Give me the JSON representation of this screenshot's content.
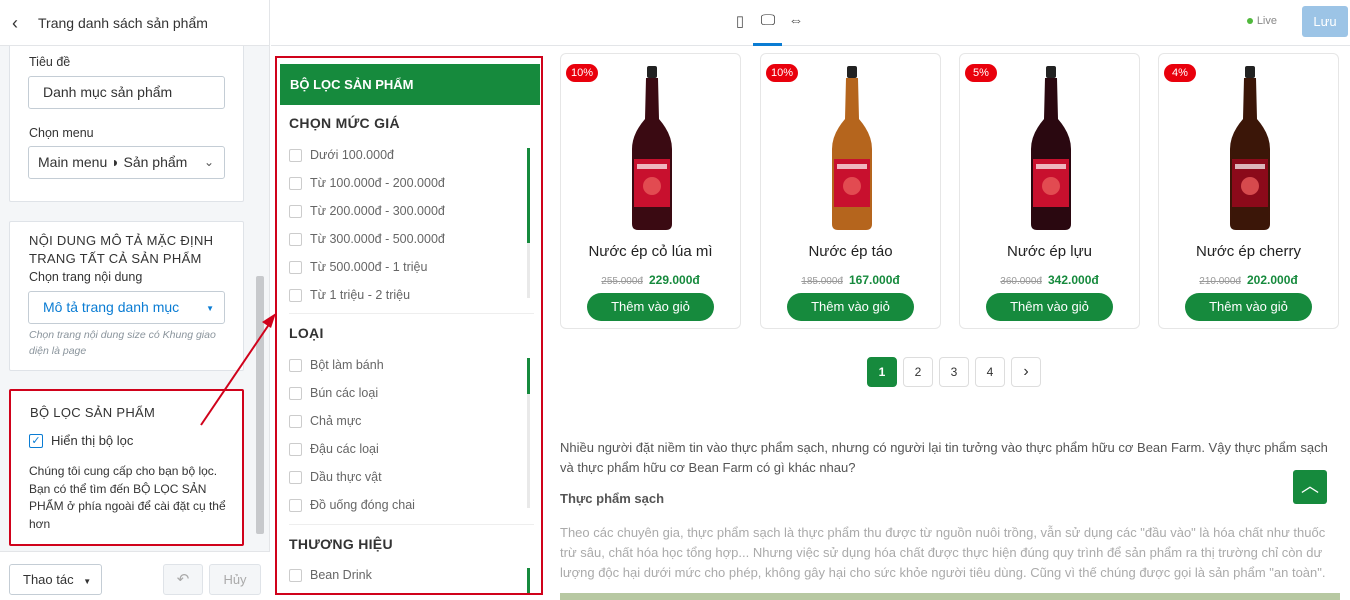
{
  "panel": {
    "title": "Trang danh sách sản phẩm",
    "back_icon": "chevron-left-icon",
    "field_title_label": "Tiêu đề",
    "field_title_value": "Danh mục sản phẩm",
    "field_menu_label": "Chọn menu",
    "field_menu_value": "Main menu ◗ Sản phẩm",
    "desc_section_heading": "NỘI DUNG MÔ TẢ MẶC ĐỊNH TRANG TẤT CẢ SẢN PHẨM",
    "desc_select_label": "Chọn trang nội dung",
    "desc_select_value": "Mô tả trang danh mục",
    "desc_hint": "Chọn trang nội dung size có Khung giao diện là page",
    "filter_heading": "BỘ LỌC SẢN PHẨM",
    "filter_checkbox_label": "Hiển thị bộ lọc",
    "filter_checked": true,
    "filter_desc": "Chúng tôi cung cấp cho bạn bộ lọc. Bạn có thể tìm đến BỘ LỌC SẢN PHẨM ở phía ngoài để cài đặt cụ thể hơn",
    "actions_label": "Thao tác",
    "undo_icon": "undo-icon",
    "cancel_label": "Hủy"
  },
  "topbar": {
    "devices": [
      "mobile-icon",
      "desktop-icon",
      "fullwidth-icon"
    ],
    "live_label": "Live",
    "save_label": "Lưu"
  },
  "filter": {
    "header": "BỘ LỌC SẢN PHẨM",
    "price_title": "CHỌN MỨC GIÁ",
    "price_options": [
      "Dưới 100.000đ",
      "Từ 100.000đ - 200.000đ",
      "Từ 200.000đ - 300.000đ",
      "Từ 300.000đ - 500.000đ",
      "Từ 500.000đ - 1 triệu",
      "Từ 1 triệu - 2 triệu"
    ],
    "type_title": "LOẠI",
    "type_options": [
      "Bột làm bánh",
      "Bún các loại",
      "Chả mực",
      "Đậu các loại",
      "Dầu thực vật",
      "Đồ uống đóng chai"
    ],
    "brand_title": "THƯƠNG HIỆU",
    "brand_options": [
      "Bean Drink"
    ]
  },
  "products": [
    {
      "name": "Nước ép cỏ lúa mì",
      "discount": "10%",
      "old_price": "255.000đ",
      "price": "229.000đ",
      "button": "Thêm vào giỏ",
      "label_color": "#c8102e",
      "bottle_color": "#3a0a12"
    },
    {
      "name": "Nước ép táo",
      "discount": "10%",
      "old_price": "185.000đ",
      "price": "167.000đ",
      "button": "Thêm vào giỏ",
      "label_color": "#c8102e",
      "bottle_color": "#b5651d"
    },
    {
      "name": "Nước ép lựu",
      "discount": "5%",
      "old_price": "360.000đ",
      "price": "342.000đ",
      "button": "Thêm vào giỏ",
      "label_color": "#c8102e",
      "bottle_color": "#2a0810"
    },
    {
      "name": "Nước ép cherry",
      "discount": "4%",
      "old_price": "210.000đ",
      "price": "202.000đ",
      "button": "Thêm vào giỏ",
      "label_color": "#8b0a1a",
      "bottle_color": "#3b1608"
    }
  ],
  "pagination": {
    "pages": [
      "1",
      "2",
      "3",
      "4"
    ],
    "current": "1",
    "next_icon": "chevron-right-icon"
  },
  "article": {
    "intro": "Nhiều người đặt niềm tin vào thực phẩm sạch, nhưng có người lại tin tưởng vào thực phẩm hữu cơ Bean Farm. Vậy thực phẩm sạch và thực phẩm hữu cơ Bean Farm có gì khác nhau?",
    "subheading": "Thực phẩm sạch",
    "body": "Theo các chuyên gia, thực phẩm sạch là thực phẩm thu được từ nguồn nuôi trồng, vẫn sử dụng các \"đầu vào\" là hóa chất như thuốc trừ sâu, chất hóa học tổng hợp... Nhưng việc sử dụng hóa chất được thực hiện đúng quy trình để sản phẩm ra thị trường chỉ còn dư lượng độc hại dưới mức cho phép, không gây hại cho sức khỏe người tiêu dùng. Cũng vì thế chúng được gọi là sản phẩm \"an toàn\".",
    "scroll_top_icon": "chevron-up-icon"
  },
  "colors": {
    "primary": "#168a3d",
    "accent": "#0a7cd3",
    "highlight": "#d0021b",
    "badge": "#e9000c"
  }
}
